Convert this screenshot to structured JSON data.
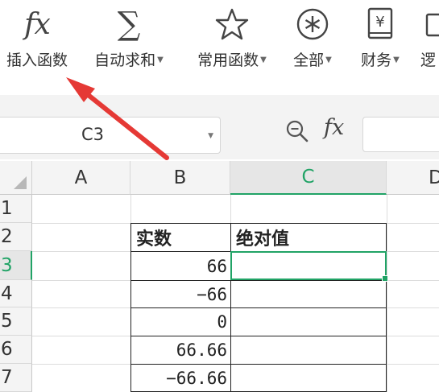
{
  "ribbon": {
    "buttons": [
      {
        "label": "插入函数",
        "icon": "fx-icon",
        "glyph": "fx",
        "caret": false
      },
      {
        "label": "自动求和",
        "icon": "sigma-icon",
        "glyph": "∑",
        "caret": true
      },
      {
        "label": "常用函数",
        "icon": "star-icon",
        "glyph": "☆",
        "caret": true
      },
      {
        "label": "全部",
        "icon": "asterisk-circle-icon",
        "glyph": "⊛",
        "caret": true
      },
      {
        "label": "财务",
        "icon": "yen-book-icon",
        "glyph": "¥",
        "caret": true
      },
      {
        "label": "逻",
        "icon": "logic-icon",
        "glyph": "",
        "caret": false
      }
    ]
  },
  "formula_bar": {
    "name_box": "C3",
    "fx_label": "fx",
    "formula_value": ""
  },
  "grid": {
    "columns": [
      "A",
      "B",
      "C",
      "D"
    ],
    "selected_column": "C",
    "rows": [
      "1",
      "2",
      "3",
      "4",
      "5",
      "6",
      "7"
    ],
    "selected_row": "3",
    "table": {
      "headers": [
        "实数",
        "绝对值"
      ],
      "values": [
        "66",
        "−66",
        "0",
        "66.66",
        "−66.66"
      ],
      "absolute_values": [
        "",
        "",
        "",
        "",
        ""
      ]
    }
  },
  "annotation": {
    "color": "#e53935",
    "points_to": "插入函数"
  },
  "colors": {
    "accent": "#21a366",
    "header_bg": "#f4f4f4",
    "band_bg": "#f3f3f3"
  }
}
